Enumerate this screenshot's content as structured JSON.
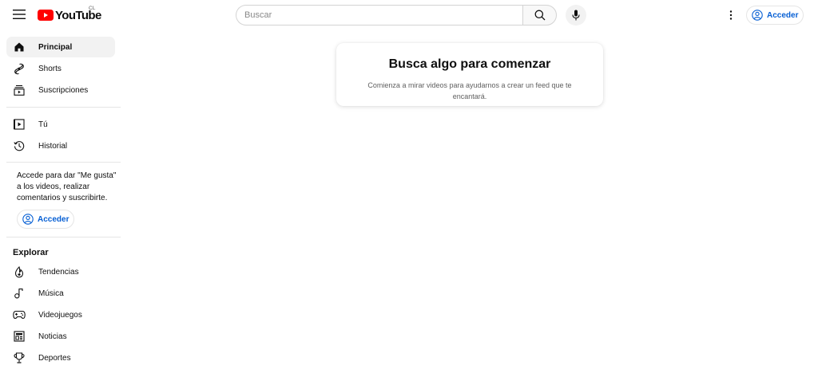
{
  "header": {
    "logo_text": "YouTube",
    "region": "CL",
    "search_placeholder": "Buscar",
    "signin_label": "Acceder"
  },
  "sidebar": {
    "primary": [
      {
        "label": "Principal",
        "icon": "home-icon",
        "active": true
      },
      {
        "label": "Shorts",
        "icon": "shorts-icon"
      },
      {
        "label": "Suscripciones",
        "icon": "subscriptions-icon"
      }
    ],
    "you": [
      {
        "label": "Tú",
        "icon": "your-channel-icon"
      },
      {
        "label": "Historial",
        "icon": "history-icon"
      }
    ],
    "signin_note": "Accede para dar \"Me gusta\" a los videos, realizar comentarios y suscribirte.",
    "signin_label": "Acceder",
    "explore_title": "Explorar",
    "explore": [
      {
        "label": "Tendencias",
        "icon": "trending-icon"
      },
      {
        "label": "Música",
        "icon": "music-icon"
      },
      {
        "label": "Videojuegos",
        "icon": "gaming-icon"
      },
      {
        "label": "Noticias",
        "icon": "news-icon"
      },
      {
        "label": "Deportes",
        "icon": "sports-icon"
      }
    ]
  },
  "main": {
    "card_title": "Busca algo para comenzar",
    "card_text": "Comienza a mirar videos para ayudarnos a crear un feed que te encantará."
  },
  "colors": {
    "brand_red": "#ff0000",
    "link_blue": "#065fd4",
    "text_primary": "#0f0f0f",
    "text_secondary": "#606060"
  }
}
